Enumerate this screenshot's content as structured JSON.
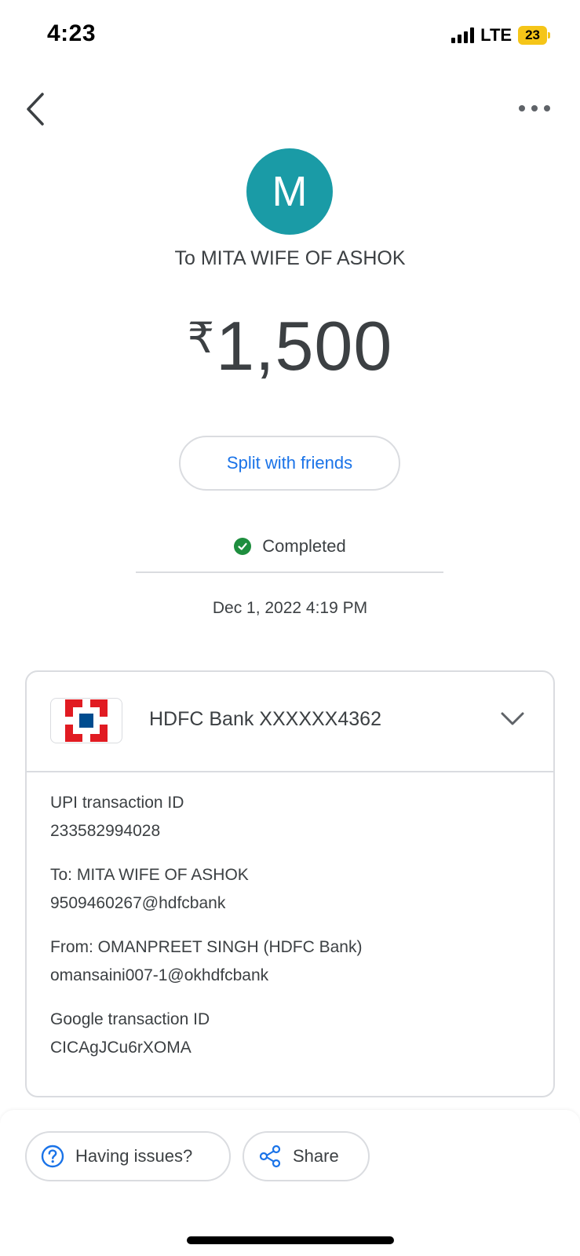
{
  "status_bar": {
    "time": "4:23",
    "network": "LTE",
    "battery": "23"
  },
  "nav": {
    "back_icon": "chevron-left-icon",
    "more_icon": "more-horiz-icon"
  },
  "payee": {
    "avatar_letter": "M",
    "avatar_color": "#1a9ba6",
    "to_line": "To MITA WIFE OF ASHOK"
  },
  "amount": {
    "currency": "₹",
    "value": "1,500"
  },
  "split_button": {
    "label": "Split with friends"
  },
  "status": {
    "text": "Completed",
    "color": "#1e8e3e"
  },
  "datetime": "Dec 1, 2022 4:19 PM",
  "bank": {
    "name": "HDFC Bank XXXXXX4362",
    "expand_icon": "chevron-down-icon"
  },
  "details": [
    {
      "label": "UPI transaction ID",
      "value": "233582994028"
    },
    {
      "label": "To: MITA WIFE OF ASHOK",
      "value": "9509460267@hdfcbank"
    },
    {
      "label": "From: OMANPREET SINGH (HDFC Bank)",
      "value": "omansaini007-1@okhdfcbank"
    },
    {
      "label": "Google transaction ID",
      "value": "CICAgJCu6rXOMA"
    }
  ],
  "actions": {
    "issues_label": "Having issues?",
    "share_label": "Share",
    "accent": "#1a73e8"
  }
}
